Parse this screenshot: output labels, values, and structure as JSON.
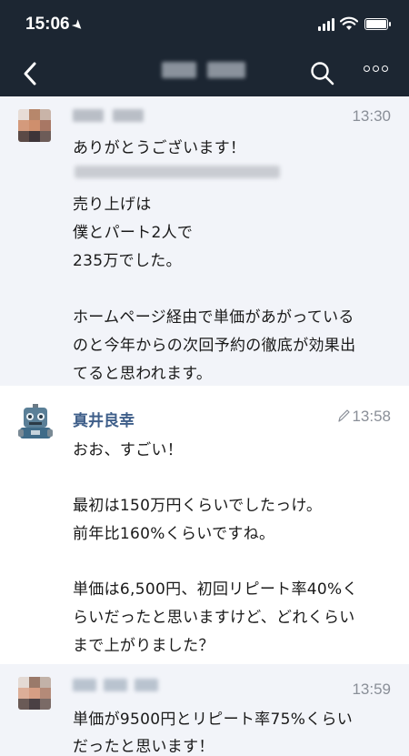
{
  "status_bar": {
    "time": "15:06"
  },
  "messages": [
    {
      "time": "13:30",
      "lines": [
        "ありがとうございます！",
        "売り上げは",
        "僕とパート2人で",
        "235万でした。",
        "ホームページ経由で単価があがっている",
        "のと今年からの次回予約の徹底が効果出",
        "てると思われます。"
      ]
    },
    {
      "sender": "真井良幸",
      "time": "13:58",
      "edited": true,
      "lines": [
        "おお、すごい！",
        "最初は150万円くらいでしたっけ。",
        "前年比160%くらいですね。",
        "単価は6,500円、初回リピート率40%く",
        "らいだったと思いますけど、どれくらい",
        "まで上がりました？"
      ]
    },
    {
      "time": "13:59",
      "lines": [
        "単価が9500円とリピート率75%くらい",
        "だったと思います！"
      ]
    }
  ]
}
